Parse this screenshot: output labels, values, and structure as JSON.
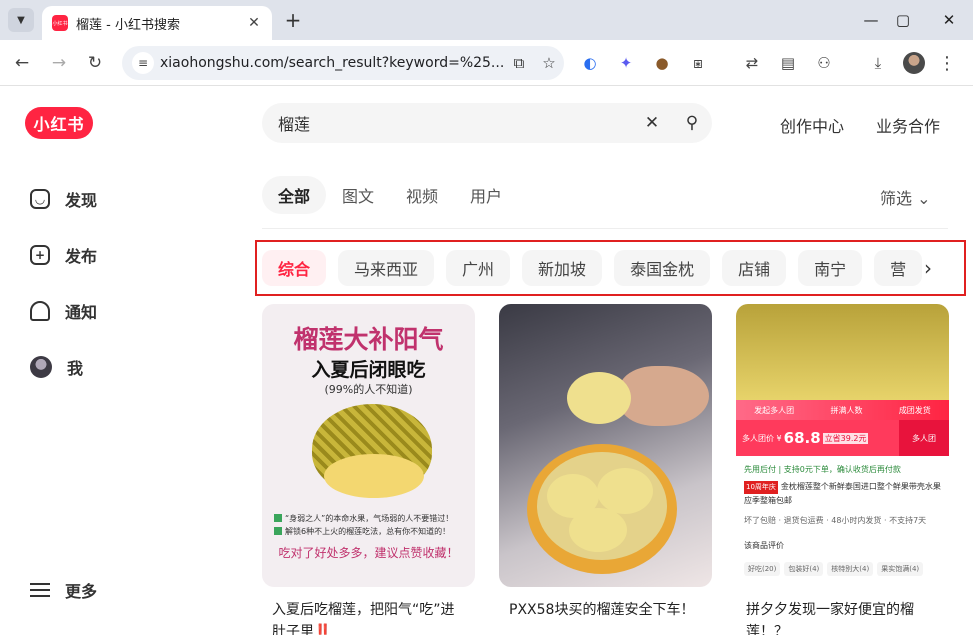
{
  "browser": {
    "tab_title": "榴莲 - 小红书搜索",
    "favicon_text": "小红书",
    "url": "xiaohongshu.com/search_result?keyword=%25...",
    "new_tab_label": "+",
    "close_label": "✕"
  },
  "logo": "小红书",
  "sidebar": {
    "items": [
      {
        "label": "发现"
      },
      {
        "label": "发布"
      },
      {
        "label": "通知"
      },
      {
        "label": "我"
      },
      {
        "label": "更多"
      }
    ]
  },
  "search": {
    "value": "榴莲"
  },
  "header_links": [
    "创作中心",
    "业务合作"
  ],
  "tabs": [
    "全部",
    "图文",
    "视频",
    "用户"
  ],
  "filter_label": "筛选",
  "chips": [
    "综合",
    "马来西亚",
    "广州",
    "新加坡",
    "泰国金枕",
    "店铺",
    "南宁",
    "营"
  ],
  "cards": [
    {
      "title": "入夏后吃榴莲，把阳气“吃”进肚子里‼️",
      "cover": {
        "heading": "榴莲大补阳气",
        "subheading": "入夏后闭眼吃",
        "note": "(99%的人不知道)",
        "line1": "“身弱之人”的本命水果，气场弱的人不要错过！",
        "line2": "解锁6种不上火的榴莲吃法，总有你不知道的！",
        "footer": "吃对了好处多多，建议点赞收藏！"
      }
    },
    {
      "title": "PXX58块买的榴莲安全下车！"
    },
    {
      "title": "拼夕夕发现一家好便宜的榴莲！？",
      "cover": {
        "banner": [
          "发起多人团",
          "拼满人数",
          "成团发货"
        ],
        "price_prefix": "多人团价 ¥",
        "price": "68.8",
        "price_tag": "立省39.2元",
        "price_side": "多人团",
        "promo": "先用后付 | 支持0元下单，确认收货后再付款",
        "product_badge": "10周年庆",
        "product": "金枕榴莲整个新鲜泰国进口整个鲜果带壳水果应季整箱包邮",
        "meta": "坏了包赔 · 退货包运费 · 48小时内发货 · 不支持7天",
        "review": "该商品评价",
        "tags": [
          "好吃(20)",
          "包装好(4)",
          "核特别大(4)",
          "果实饱满(4)"
        ]
      }
    }
  ]
}
